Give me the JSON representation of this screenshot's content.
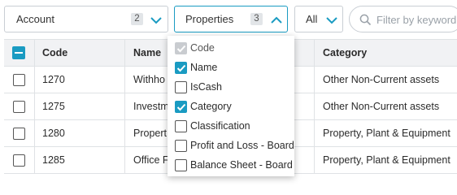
{
  "filters": {
    "account": {
      "label": "Account",
      "count": "2"
    },
    "properties": {
      "label": "Properties",
      "count": "3"
    },
    "all": {
      "label": "All"
    },
    "search": {
      "placeholder": "Filter by keyword"
    }
  },
  "colors": {
    "accent": "#1a9bc2",
    "header_bg": "#f1f2f4"
  },
  "table": {
    "headers": {
      "code": "Code",
      "name": "Name",
      "category": "Category"
    },
    "rows": [
      {
        "code": "1270",
        "name": "Withho",
        "category": "Other Non-Current assets"
      },
      {
        "code": "1275",
        "name": "Investm",
        "category": "Other Non-Current assets"
      },
      {
        "code": "1280",
        "name": "Propert",
        "category": "Property, Plant & Equipment"
      },
      {
        "code": "1285",
        "name": "Office F",
        "category": "Property, Plant & Equipment"
      }
    ]
  },
  "properties_menu": {
    "options": [
      {
        "label": "Code",
        "state": "disabled-checked"
      },
      {
        "label": "Name",
        "state": "checked"
      },
      {
        "label": "IsCash",
        "state": "unchecked"
      },
      {
        "label": "Category",
        "state": "checked"
      },
      {
        "label": "Classification",
        "state": "unchecked"
      },
      {
        "label": "Profit and Loss - Board",
        "state": "unchecked"
      },
      {
        "label": "Balance Sheet - Board",
        "state": "unchecked"
      }
    ]
  }
}
